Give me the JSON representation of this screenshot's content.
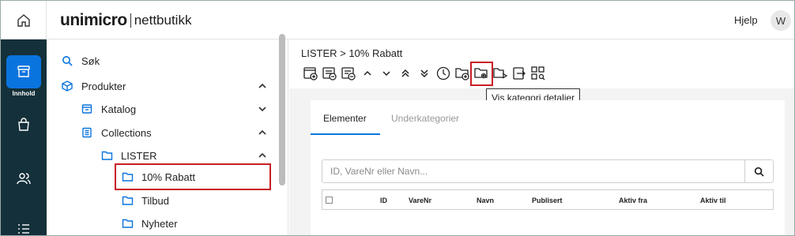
{
  "header": {
    "logo_brand": "unimicro",
    "logo_product": "nettbutikk",
    "help_label": "Hjelp",
    "avatar_initial": "W"
  },
  "rail": {
    "active_label": "Innhold",
    "icons": [
      "box-icon",
      "shopping-bag-icon",
      "users-icon",
      "list-icon"
    ],
    "accent_color": "#0a74de",
    "background_color": "#14303a"
  },
  "sidebar": {
    "items": [
      {
        "label": "Søk",
        "icon": "search-icon"
      },
      {
        "label": "Produkter",
        "icon": "cube-icon",
        "expanded": true
      },
      {
        "label": "Katalog",
        "icon": "catalog-icon",
        "expanded": false
      },
      {
        "label": "Collections",
        "icon": "collection-icon",
        "expanded": true
      },
      {
        "label": "LISTER",
        "icon": "folder-icon",
        "expanded": true
      },
      {
        "label": "10% Rabatt",
        "icon": "folder-icon",
        "selected": true
      },
      {
        "label": "Tilbud",
        "icon": "folder-icon"
      },
      {
        "label": "Nyheter",
        "icon": "folder-icon"
      }
    ]
  },
  "main": {
    "breadcrumb": "LISTER > 10% Rabatt",
    "toolbar_icons": [
      "new-item-icon",
      "edit-list-icon",
      "remove-list-icon",
      "chevron-up-icon",
      "chevron-down-icon",
      "double-chevron-up-icon",
      "double-chevron-down-icon",
      "clock-icon",
      "add-folder-icon",
      "folder-settings-icon",
      "move-folder-icon",
      "export-icon",
      "grid-search-icon"
    ],
    "tooltip": "Vis kategori detaljer",
    "tabs": [
      {
        "label": "Elementer",
        "active": true
      },
      {
        "label": "Underkategorier",
        "active": false
      }
    ],
    "search_placeholder": "ID, VareNr eller Navn...",
    "columns": [
      "ID",
      "VareNr",
      "Navn",
      "Publisert",
      "Aktiv fra",
      "Aktiv til"
    ]
  },
  "colors": {
    "highlight_border": "#c81e24"
  }
}
